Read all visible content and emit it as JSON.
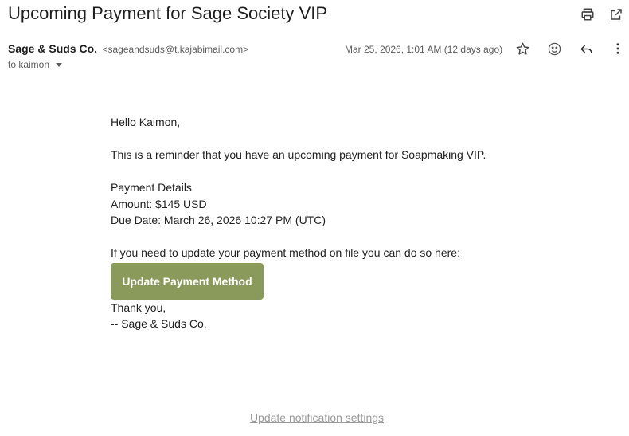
{
  "email": {
    "subject": "Upcoming Payment for Sage Society VIP",
    "sender_name": "Sage & Suds Co.",
    "sender_email": "<sageandsuds@t.kajabimail.com>",
    "to_label": "to kaimon",
    "date": "Mar 25, 2026, 1:01 AM (12 days ago)"
  },
  "body": {
    "greeting": "Hello Kaimon,",
    "reminder": "This is a reminder that you have an upcoming payment for Soapmaking VIP.",
    "details_heading": "Payment Details",
    "amount": "Amount: $145 USD",
    "due_date": "Due Date: March 26, 2026 10:27 PM (UTC)",
    "update_prompt": "If you need to update your payment method on file you can do so here:",
    "cta_label": "Update Payment Method",
    "thanks": "Thank you,",
    "signature": "-- Sage & Suds Co."
  },
  "footer": {
    "link_label": "Update notification settings"
  },
  "icons": {
    "print": "print-icon",
    "open_new_window": "open-in-new-icon",
    "star": "star-icon",
    "emoji": "emoji-icon",
    "reply": "reply-icon",
    "more": "more-vert-icon"
  },
  "colors": {
    "cta_background": "#8a9a5b",
    "cta_text": "#ffffff",
    "footer_link": "#9a9a9a"
  }
}
